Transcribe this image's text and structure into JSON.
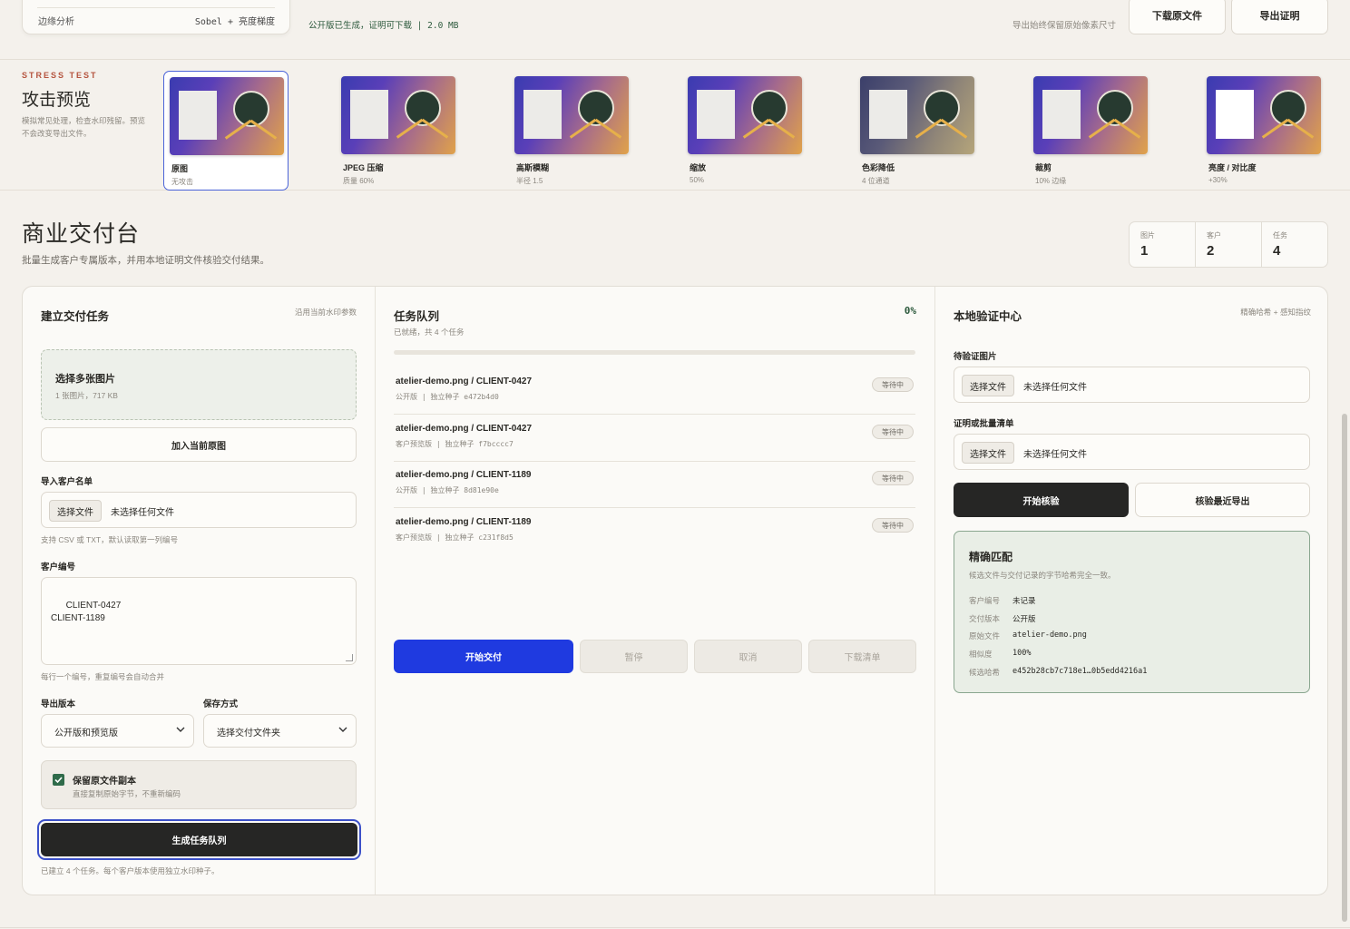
{
  "top": {
    "edge_label": "边缘分析",
    "edge_value": "Sobel + 亮度梯度",
    "status": "公开版已生成，证明可下载 | 2.0 MB",
    "hint": "导出始终保留原始像素尺寸",
    "download_btn": "下载原文件",
    "export_btn": "导出证明"
  },
  "stress": {
    "kicker": "STRESS TEST",
    "title": "攻击预览",
    "desc": "模拟常见处理，检查水印残留。预览不会改变导出文件。",
    "items": [
      {
        "label": "原图",
        "sub": "无攻击",
        "selected": true
      },
      {
        "label": "JPEG 压缩",
        "sub": "质量 60%"
      },
      {
        "label": "高斯模糊",
        "sub": "半径 1.5"
      },
      {
        "label": "缩放",
        "sub": "50%"
      },
      {
        "label": "色彩降低",
        "sub": "4 位通道"
      },
      {
        "label": "裁剪",
        "sub": "10% 边缘"
      },
      {
        "label": "亮度 / 对比度",
        "sub": "+30%"
      }
    ]
  },
  "main": {
    "title": "商业交付台",
    "subtitle": "批量生成客户专属版本，并用本地证明文件核验交付结果。",
    "stats": [
      {
        "label": "图片",
        "value": "1"
      },
      {
        "label": "客户",
        "value": "2"
      },
      {
        "label": "任务",
        "value": "4"
      }
    ]
  },
  "build": {
    "title": "建立交付任务",
    "hint": "沿用当前水印参数",
    "dropzone_title": "选择多张图片",
    "dropzone_sub": "1 张图片，717 KB",
    "add_current": "加入当前原图",
    "import_label": "导入客户名单",
    "file_btn": "选择文件",
    "no_file": "未选择任何文件",
    "import_hint": "支持 CSV 或 TXT，默认读取第一列编号",
    "ids_label": "客户编号",
    "ids_value": "CLIENT-0427\nCLIENT-1189",
    "ids_hint": "每行一个编号，重复编号会自动合并",
    "version_label": "导出版本",
    "version_value": "公开版和预览版",
    "save_label": "保存方式",
    "save_value": "选择交付文件夹",
    "keep_title": "保留原文件副本",
    "keep_sub": "直接复制原始字节，不重新编码",
    "keep_checked": true,
    "generate_btn": "生成任务队列",
    "generate_hint": "已建立 4 个任务。每个客户版本使用独立水印种子。"
  },
  "queue": {
    "title": "任务队列",
    "status": "已就绪，共 4 个任务",
    "percent": "0%",
    "progress": 0,
    "rows": [
      {
        "title": "atelier-demo.png / CLIENT-0427",
        "sub": "公开版 | 独立种子 e472b4d0",
        "badge": "等待中"
      },
      {
        "title": "atelier-demo.png / CLIENT-0427",
        "sub": "客户预览版 | 独立种子 f7bcccc7",
        "badge": "等待中"
      },
      {
        "title": "atelier-demo.png / CLIENT-1189",
        "sub": "公开版 | 独立种子 8d81e90e",
        "badge": "等待中"
      },
      {
        "title": "atelier-demo.png / CLIENT-1189",
        "sub": "客户预览版 | 独立种子 c231f8d5",
        "badge": "等待中"
      }
    ],
    "start_btn": "开始交付",
    "pause_btn": "暂停",
    "cancel_btn": "取消",
    "download_btn": "下载清单"
  },
  "verify": {
    "title": "本地验证中心",
    "hint": "精确哈希 + 感知指纹",
    "pending_label": "待验证图片",
    "proof_label": "证明或批量清单",
    "file_btn": "选择文件",
    "no_file": "未选择任何文件",
    "start_btn": "开始核验",
    "recent_btn": "核验最近导出",
    "match_title": "精确匹配",
    "match_desc": "候选文件与交付记录的字节哈希完全一致。",
    "match_rows": [
      {
        "k": "客户编号",
        "v": "未记录"
      },
      {
        "k": "交付版本",
        "v": "公开版"
      },
      {
        "k": "原始文件",
        "v": "atelier-demo.png"
      },
      {
        "k": "相似度",
        "v": "100%"
      },
      {
        "k": "候选哈希",
        "v": "e452b28cb7c718e1…0b5edd4216a1"
      }
    ]
  }
}
